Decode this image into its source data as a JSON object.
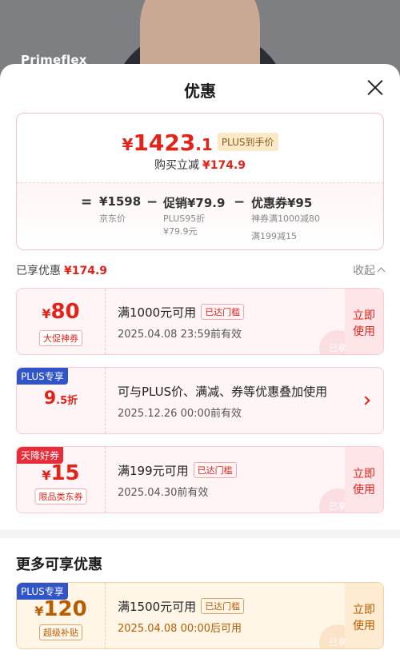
{
  "background": {
    "brand": "Primeflex"
  },
  "sheet": {
    "title": "优惠"
  },
  "summary": {
    "price_symbol": "¥",
    "price_int": "1423",
    "price_dec": ".1",
    "plus_label": "PLUS到手价",
    "save_label": "购买立减",
    "save_amount": "¥174.9",
    "calc": {
      "eq": "=",
      "jd_price": "¥1598",
      "jd_label": "京东价",
      "minus1": "−",
      "promo": "促销¥79.9",
      "promo_sub1": "PLUS95折",
      "promo_sub2": "¥79.9元",
      "minus2": "−",
      "coupon": "优惠券¥95",
      "coupon_sub1": "神券满1000减80",
      "coupon_sub2": "满199减15"
    }
  },
  "applied": {
    "label": "已享优惠",
    "amount": "¥174.9",
    "collapse": "收起"
  },
  "coupons": [
    {
      "symbol": "¥",
      "value": "80",
      "unit": "",
      "kind": "大促神券",
      "ribbon": "",
      "condition": "满1000元可用",
      "tag": "已达门槛",
      "date": "2025.04.08 23:59前有效",
      "action": "立即使用",
      "stamp": "已享"
    },
    {
      "symbol": "",
      "value": "9",
      "unit": ".5折",
      "kind": "",
      "ribbon": "PLUS专享",
      "condition": "可与PLUS价、满减、券等优惠叠加使用",
      "tag": "",
      "date": "2025.12.26 00:00前有效",
      "action": "",
      "stamp": ""
    },
    {
      "symbol": "¥",
      "value": "15",
      "unit": "",
      "kind": "限品类东券",
      "ribbon": "天降好券",
      "condition": "满199元可用",
      "tag": "已达门槛",
      "date": "2025.04.30前有效",
      "action": "立即使用",
      "stamp": "已享"
    }
  ],
  "more": {
    "title": "更多可享优惠",
    "coupon": {
      "symbol": "¥",
      "value": "120",
      "kind": "超级补贴",
      "ribbon": "PLUS专享",
      "condition": "满1500元可用",
      "tag": "已达门槛",
      "date": "2025.04.08 00:00后可用",
      "action": "立即使用",
      "stamp": "已享"
    }
  },
  "colors": {
    "accent_red": "#e2231a",
    "plus_blue": "#2f55c9",
    "gold": "#b85c00"
  }
}
